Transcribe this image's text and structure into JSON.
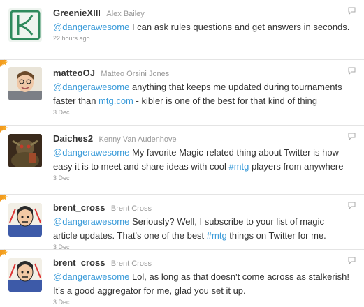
{
  "tweets": [
    {
      "screen_name": "GreenieXIII",
      "full_name": "Alex Bailey",
      "mention": "@dangerawesome",
      "text_a": " I can ask rules questions and get answers in seconds.",
      "time": "22 hours ago",
      "favorited": false
    },
    {
      "screen_name": "matteoOJ",
      "full_name": "Matteo Orsini Jones",
      "mention": "@dangerawesome",
      "text_a": " anything that keeps me updated during tournaments faster than ",
      "link": "mtg.com",
      "text_b": " - kibler is one of the best for that kind of thing",
      "time": "3 Dec",
      "favorited": true
    },
    {
      "screen_name": "Daiches2",
      "full_name": "Kenny Van Audenhove",
      "mention": "@dangerawesome",
      "text_a": " My favorite Magic-related thing about Twitter is how easy it is to meet and share ideas with cool ",
      "link": "#mtg",
      "text_b": " players from anywhere",
      "time": "3 Dec",
      "favorited": true
    },
    {
      "screen_name": "brent_cross",
      "full_name": "Brent Cross",
      "mention": "@dangerawesome",
      "text_a": " Seriously? Well, I subscribe to your list of magic article updates. That's one of the best ",
      "link": "#mtg",
      "text_b": " things on Twitter for me.",
      "time": "3 Dec",
      "favorited": true
    },
    {
      "screen_name": "brent_cross",
      "full_name": "Brent Cross",
      "mention": "@dangerawesome",
      "text_a": " Lol, as long as that doesn't come across as stalkerish! It's a good aggregator for me, glad you set it up.",
      "time": "3 Dec",
      "favorited": true
    }
  ],
  "icons": {
    "favorite": "star-icon",
    "reply": "reply-icon"
  },
  "colors": {
    "link": "#3a9bd9",
    "favorite_corner": "#f29a1f",
    "muted": "#999999"
  }
}
